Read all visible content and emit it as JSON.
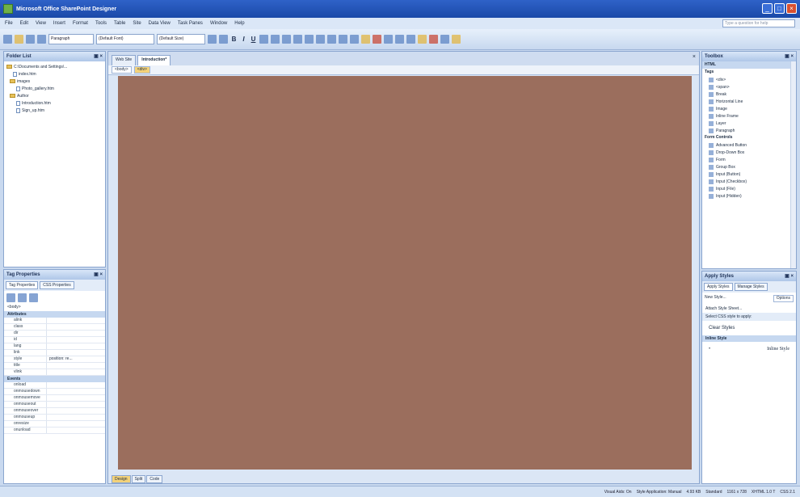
{
  "window": {
    "title": "Microsoft Office SharePoint Designer",
    "icon": "sharepoint-designer-icon"
  },
  "menu": [
    "File",
    "Edit",
    "View",
    "Insert",
    "Format",
    "Tools",
    "Table",
    "Site",
    "Data View",
    "Task Panes",
    "Window",
    "Help"
  ],
  "help_box": "Type a question for help",
  "toolbar": {
    "style_select": "Paragraph",
    "font_select": "(Default Font)",
    "size_select": "(Default Size)",
    "bold": "B",
    "italic": "I",
    "underline": "U"
  },
  "folder_list": {
    "title": "Folder List",
    "items": [
      {
        "type": "folder",
        "label": "C:\\Documents and Settings\\..."
      },
      {
        "type": "file",
        "label": "index.htm"
      },
      {
        "type": "folder",
        "label": "images"
      },
      {
        "type": "file",
        "label": "Photo_gallery.htm"
      },
      {
        "type": "folder",
        "label": "Author"
      },
      {
        "type": "file",
        "label": "Introduction.htm"
      },
      {
        "type": "file",
        "label": "Sign_up.htm"
      }
    ]
  },
  "tag_properties": {
    "title": "Tag Properties",
    "tabs": [
      "Tag Properties",
      "CSS Properties"
    ],
    "tag": "<body>",
    "categories": [
      {
        "name": "Attributes",
        "rows": [
          {
            "k": "alink",
            "v": ""
          },
          {
            "k": "class",
            "v": ""
          },
          {
            "k": "dir",
            "v": ""
          },
          {
            "k": "id",
            "v": ""
          },
          {
            "k": "lang",
            "v": ""
          },
          {
            "k": "link",
            "v": ""
          },
          {
            "k": "style",
            "v": "position: re..."
          },
          {
            "k": "title",
            "v": ""
          },
          {
            "k": "vlink",
            "v": ""
          }
        ]
      },
      {
        "name": "Events",
        "rows": [
          {
            "k": "onload",
            "v": ""
          },
          {
            "k": "onmousedown",
            "v": ""
          },
          {
            "k": "onmousemove",
            "v": ""
          },
          {
            "k": "onmouseout",
            "v": ""
          },
          {
            "k": "onmouseover",
            "v": ""
          },
          {
            "k": "onmouseup",
            "v": ""
          },
          {
            "k": "onresize",
            "v": ""
          },
          {
            "k": "onunload",
            "v": ""
          }
        ]
      }
    ]
  },
  "document": {
    "tabs": [
      "Web Site",
      "Introduction*"
    ],
    "breadcrumb": [
      "<body>",
      "<div>"
    ],
    "view_tabs": [
      "Design",
      "Split",
      "Code"
    ],
    "canvas_color": "#9b6e5d"
  },
  "toolbox": {
    "title": "Toolbox",
    "html_group": "HTML",
    "tags_group": "Tags",
    "tags": [
      "<div>",
      "<span>",
      "Break",
      "Horizontal Line",
      "Image",
      "Inline Frame",
      "Layer",
      "Paragraph"
    ],
    "form_group": "Form Controls",
    "form": [
      "Advanced Button",
      "Drop-Down Box",
      "Form",
      "Group Box",
      "Input (Button)",
      "Input (Checkbox)",
      "Input (File)",
      "Input (Hidden)"
    ]
  },
  "apply_styles": {
    "title": "Apply Styles",
    "tabs": [
      "Apply Styles",
      "Manage Styles"
    ],
    "new_style": "New Style...",
    "options": "Options",
    "attach": "Attach Style Sheet...",
    "select_label": "Select CSS style to apply:",
    "clear": "Clear Styles",
    "inline_section": "Inline Style",
    "inline_label": "Inline Style"
  },
  "status": [
    "Visual Aids: On",
    "Style Application: Manual",
    "4.93 KB",
    "Standard",
    "1161 x 728",
    "XHTML 1.0 T",
    "CSS 2.1"
  ],
  "colors": {
    "title_bar": "#1a49a8",
    "canvas": "#9b6e5d",
    "accent": "#f3d27a"
  }
}
